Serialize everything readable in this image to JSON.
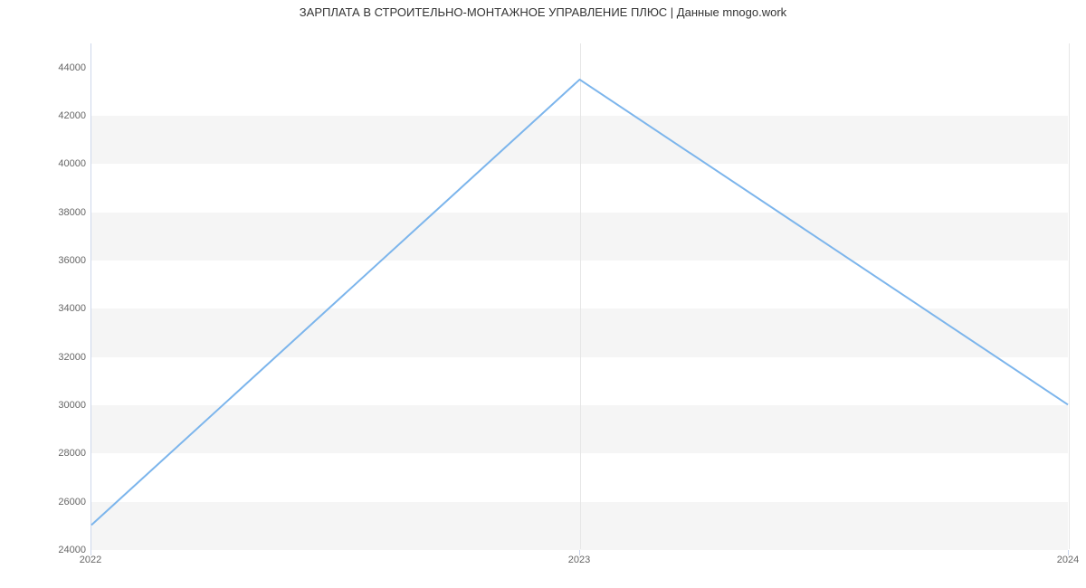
{
  "chart_data": {
    "type": "line",
    "title": "ЗАРПЛАТА В  СТРОИТЕЛЬНО-МОНТАЖНОЕ УПРАВЛЕНИЕ ПЛЮС | Данные mnogo.work",
    "x": [
      "2022",
      "2023",
      "2024"
    ],
    "values": [
      25000,
      43500,
      30000
    ],
    "y_ticks": [
      24000,
      26000,
      28000,
      30000,
      32000,
      34000,
      36000,
      38000,
      40000,
      42000,
      44000
    ],
    "ylim": [
      24000,
      45000
    ],
    "line_color": "#7cb5ec"
  }
}
